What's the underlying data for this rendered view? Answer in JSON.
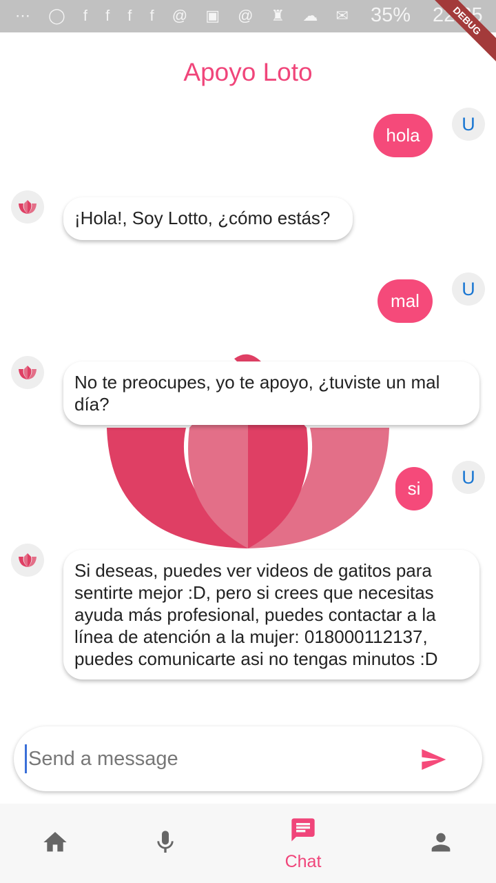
{
  "status_bar": {
    "battery": "35%",
    "time": "22:25",
    "debug_banner": "DEBUG"
  },
  "header": {
    "title": "Apoyo Loto"
  },
  "messages": [
    {
      "sender": "user",
      "avatar": "U",
      "text": "hola"
    },
    {
      "sender": "bot",
      "text": "¡Hola!, Soy Lotto, ¿cómo estás?"
    },
    {
      "sender": "user",
      "avatar": "U",
      "text": "mal"
    },
    {
      "sender": "bot",
      "text": "No te preocupes, yo te apoyo, ¿tuviste un mal día?"
    },
    {
      "sender": "user",
      "avatar": "U",
      "text": "si"
    },
    {
      "sender": "bot",
      "text": "Si deseas, puedes ver videos de gatitos para sentirte mejor :D, pero si crees que necesitas ayuda más profesional, puedes contactar a la línea de atención a la mujer: 018000112137, puedes comunicarte asi no tengas minutos :D"
    }
  ],
  "composer": {
    "placeholder": "Send a message",
    "value": ""
  },
  "bottom_nav": {
    "items": [
      {
        "icon": "home-icon"
      },
      {
        "icon": "mic-icon"
      },
      {
        "icon": "chat-icon",
        "label": "Chat",
        "active": true
      },
      {
        "icon": "person-icon"
      }
    ]
  },
  "colors": {
    "accent": "#f54a7a",
    "title": "#f0457a",
    "user_initial": "#1976d2"
  }
}
